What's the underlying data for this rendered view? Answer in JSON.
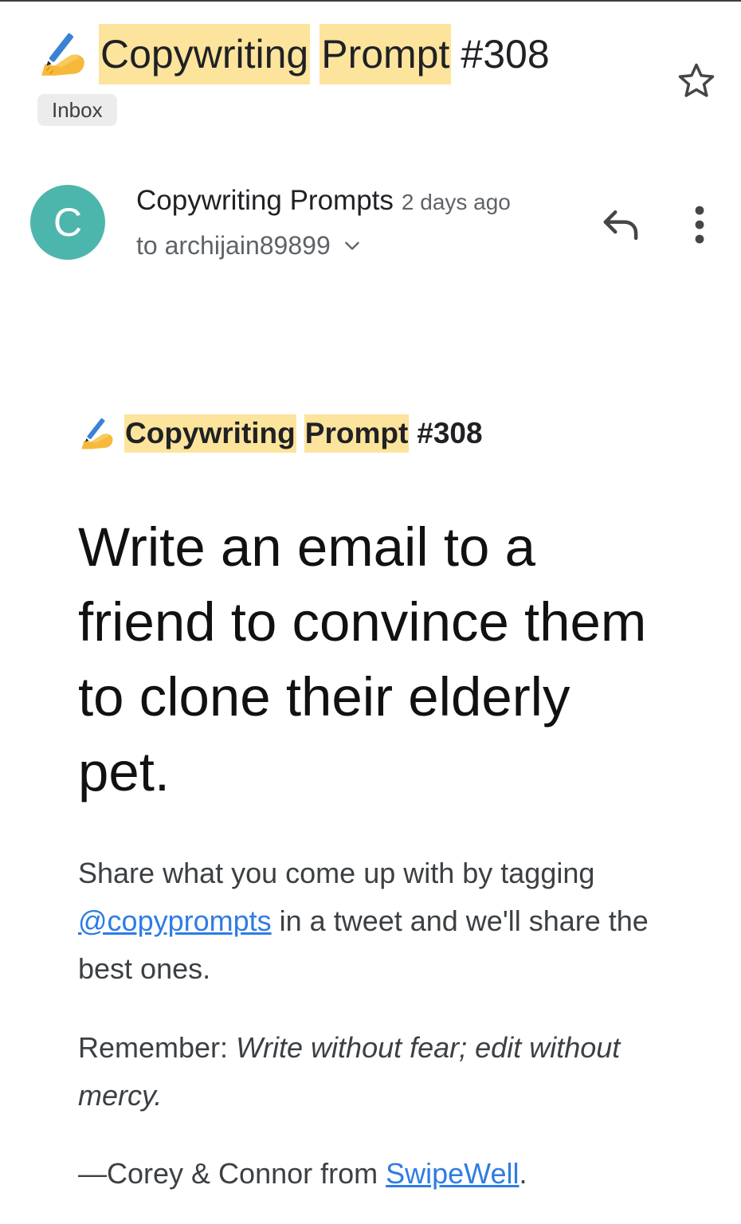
{
  "subject": {
    "emoji_icon": "writing-hand-icon",
    "word1": "Copywriting",
    "word2": "Prompt",
    "number": "#308",
    "highlight_color": "#fde49c"
  },
  "label": "Inbox",
  "sender": {
    "avatar_letter": "C",
    "avatar_color": "#4db6ac",
    "name": "Copywriting Prompts",
    "time": "2 days ago",
    "recipient": "to archijain89899"
  },
  "body": {
    "heading": {
      "word1": "Copywriting",
      "word2": "Prompt",
      "number": "#308"
    },
    "prompt": "Write an email to a friend to convince them to clone their elderly pet.",
    "share": {
      "before": "Share what you come up with by tagging ",
      "link": "@copyprompts",
      "after": " in a tweet and we'll share the best ones."
    },
    "remember": {
      "label": "Remember: ",
      "quote": "Write without fear; edit without mercy."
    },
    "signoff": {
      "text": "—Corey & Connor from ",
      "link": "SwipeWell",
      "end": "."
    },
    "link_color": "#2f7ce3"
  }
}
